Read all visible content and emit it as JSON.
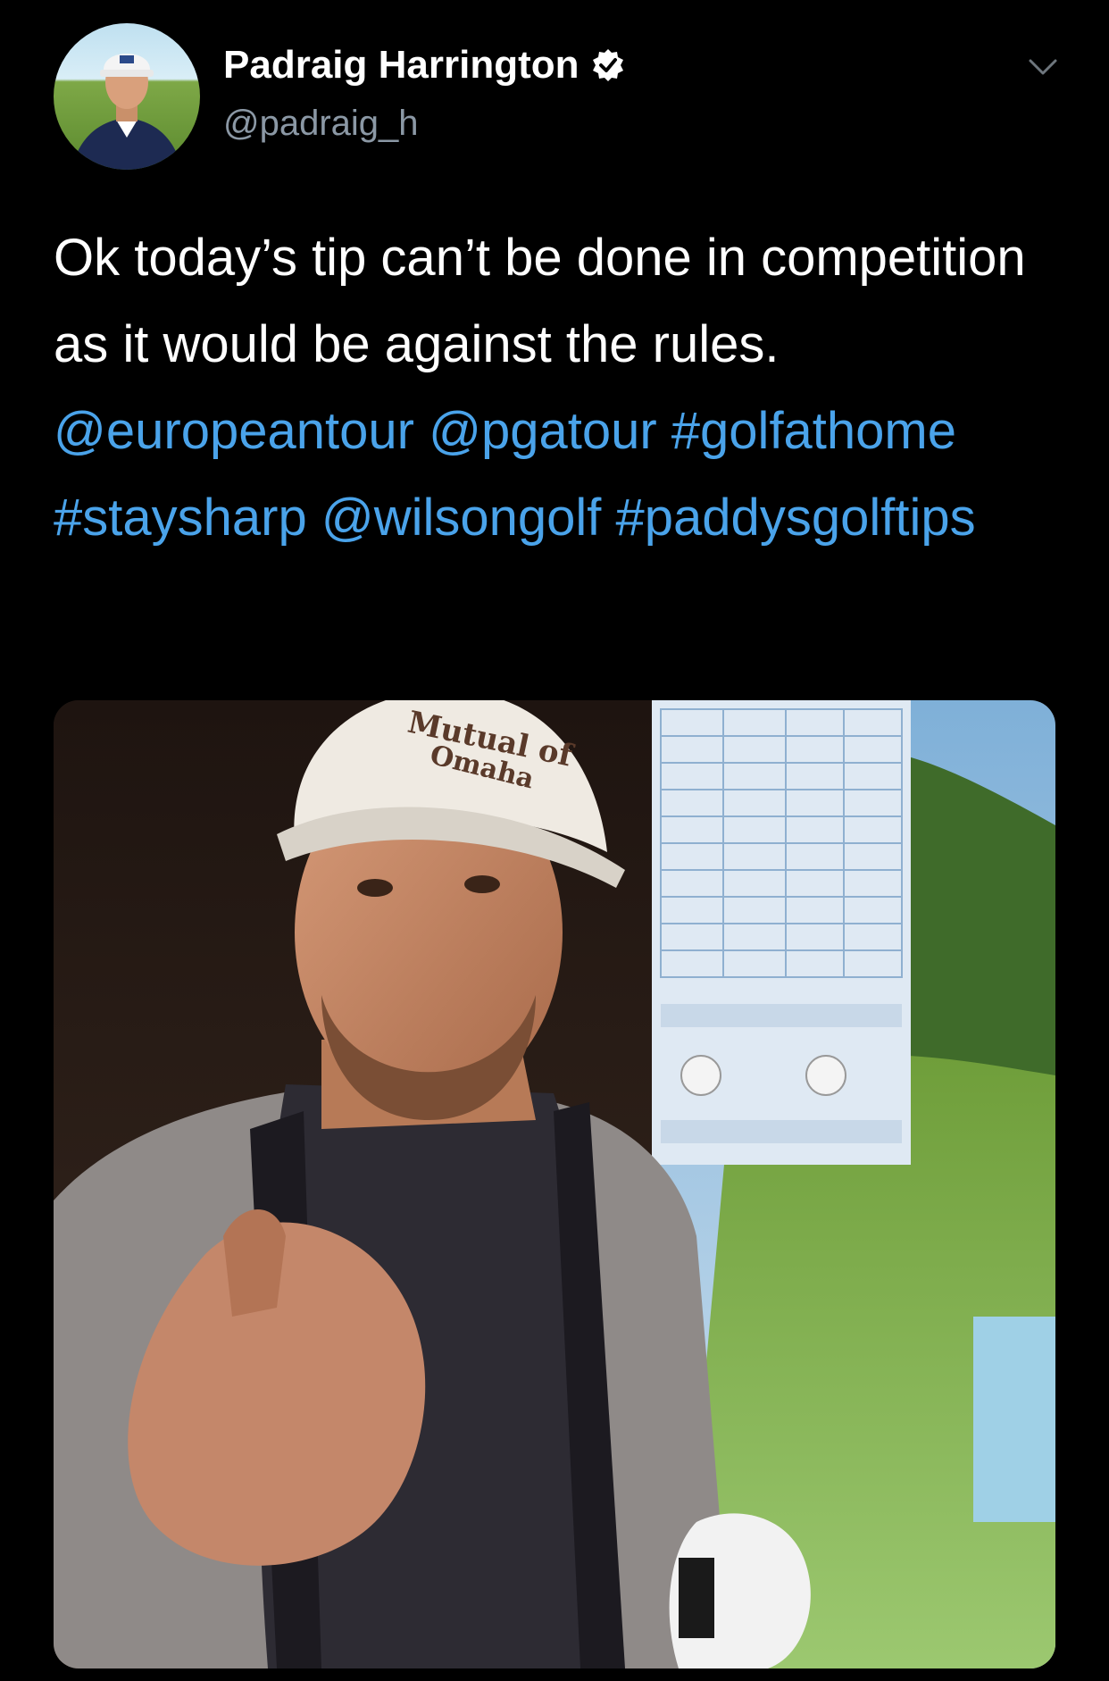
{
  "tweet": {
    "author": {
      "display_name": "Padraig Harrington",
      "handle": "@padraig_h",
      "verified": true,
      "avatar_icon": "profile-avatar"
    },
    "menu_icon": "chevron-down-icon",
    "text_segments": [
      {
        "text": "Ok today’s tip can’t be done in competition as it would be against the rules. ",
        "type": "text"
      },
      {
        "text": "@europeantour",
        "type": "mention"
      },
      {
        "text": " ",
        "type": "text"
      },
      {
        "text": "@pgatour",
        "type": "mention"
      },
      {
        "text": " ",
        "type": "text"
      },
      {
        "text": "#golfathome",
        "type": "hashtag"
      },
      {
        "text": " ",
        "type": "text"
      },
      {
        "text": "#staysharp",
        "type": "hashtag"
      },
      {
        "text": " ",
        "type": "text"
      },
      {
        "text": "@wilsongolf",
        "type": "mention"
      },
      {
        "text": " ",
        "type": "text"
      },
      {
        "text": "#paddysgolftips",
        "type": "hashtag"
      }
    ],
    "media": {
      "type": "video-thumbnail",
      "cap_text_line1": "Mutual of",
      "cap_text_line2": "Omaha"
    }
  },
  "colors": {
    "background": "#000000",
    "text": "#ffffff",
    "secondary": "#8b98a5",
    "link": "#4aa3ea",
    "verified_badge": "#ffffff"
  }
}
